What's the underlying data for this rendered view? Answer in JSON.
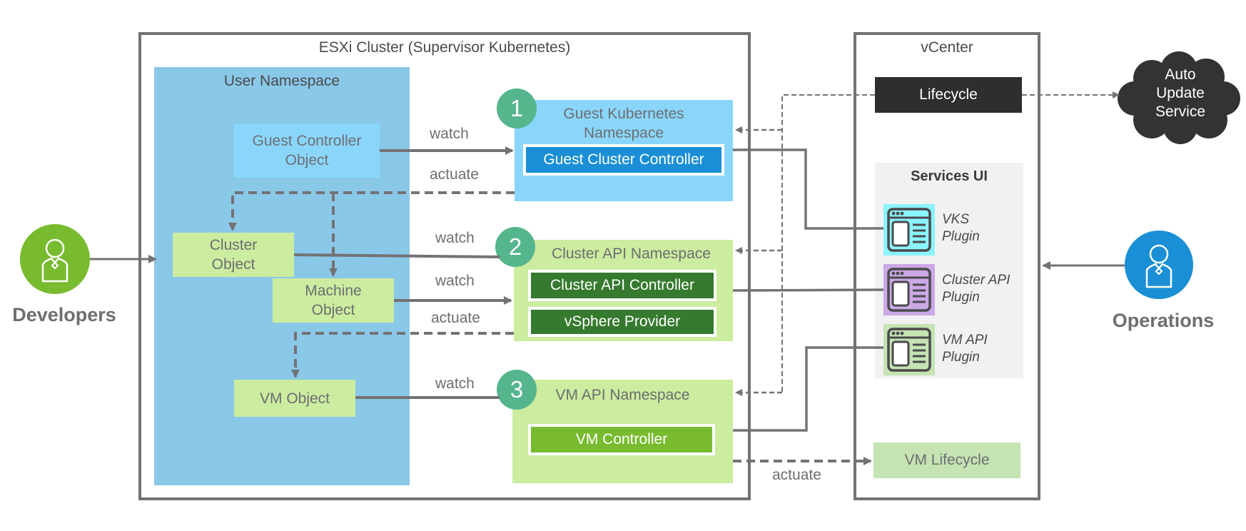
{
  "colors": {
    "frame": "#737275",
    "user_namespace": "#8ac8e8",
    "guest_ns": "#8ad6fb",
    "light_green": "#ccec9f",
    "guest_controller": "#1a8fd6",
    "cluster_api_controller": "#357a2e",
    "vm_controller": "#78bb2f",
    "badge": "#55b58d",
    "lifecycle": "#2e2e2e",
    "developers": "#78bb2f",
    "operations": "#1a8fd6",
    "services_ui_bg": "#f1f1f1",
    "plugin_vks": "#8af4ff",
    "plugin_cluster_api": "#cba8e6",
    "plugin_vm_api": "#c5e3b3",
    "vm_lifecycle": "#c5e3b3"
  },
  "esxi_cluster": {
    "title": "ESXi Cluster (Supervisor Kubernetes)",
    "user_namespace": {
      "title": "User Namespace",
      "objects": {
        "guest_controller_object": [
          "Guest Controller",
          "Object"
        ],
        "cluster_object": [
          "Cluster",
          "Object"
        ],
        "machine_object": [
          "Machine",
          "Object"
        ],
        "vm_object": [
          "VM Object"
        ]
      }
    },
    "namespaces": [
      {
        "badge": "1",
        "title_lines": [
          "Guest Kubernetes",
          "Namespace"
        ],
        "controllers": [
          "Guest Cluster Controller"
        ]
      },
      {
        "badge": "2",
        "title_lines": [
          "Cluster API Namespace"
        ],
        "controllers": [
          "Cluster API Controller",
          "vSphere Provider"
        ]
      },
      {
        "badge": "3",
        "title_lines": [
          "VM API Namespace"
        ],
        "controllers": [
          "VM Controller"
        ]
      }
    ]
  },
  "edge_labels": {
    "watch_1": "watch",
    "actuate_1": "actuate",
    "watch_2a": "watch",
    "watch_2b": "watch",
    "actuate_2": "actuate",
    "watch_3": "watch",
    "actuate_vm_lifecycle": "actuate"
  },
  "vcenter": {
    "title": "vCenter",
    "lifecycle": "Lifecycle",
    "services_ui": {
      "title": "Services UI",
      "plugins": [
        {
          "icon": "browser-window-icon",
          "lines": [
            "VKS",
            "Plugin"
          ]
        },
        {
          "icon": "browser-window-icon",
          "lines": [
            "Cluster API",
            "Plugin"
          ]
        },
        {
          "icon": "browser-window-icon",
          "lines": [
            "VM API",
            "Plugin"
          ]
        }
      ]
    },
    "vm_lifecycle": "VM Lifecycle"
  },
  "auto_update_service": [
    "Auto",
    "Update",
    "Service"
  ],
  "personas": {
    "developers": {
      "label": "Developers",
      "icon": "user-icon"
    },
    "operations": {
      "label": "Operations",
      "icon": "user-icon"
    }
  }
}
